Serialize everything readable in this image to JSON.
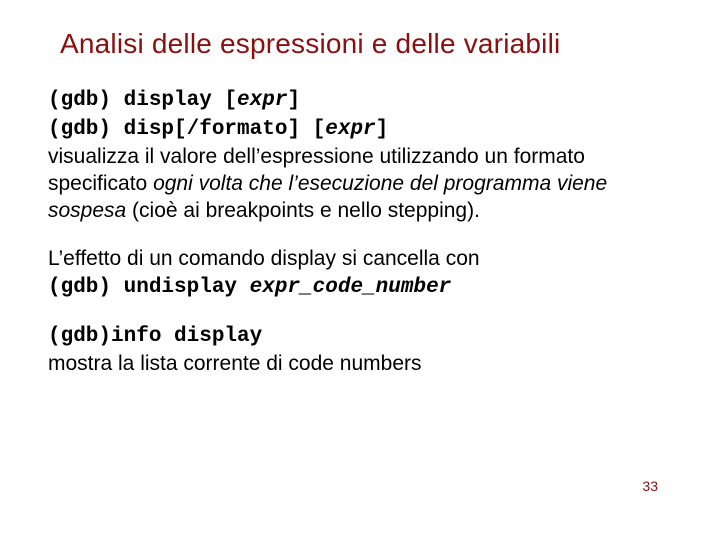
{
  "title": "Analisi delle espressioni e delle variabili",
  "p1": {
    "l1a": "(gdb) display [",
    "l1b": "expr",
    "l1c": "]",
    "l2a": "(gdb) disp[/formato] [",
    "l2b": "expr",
    "l2c": "]",
    "t1": "visualizza il valore dell’espressione utilizzando un formato specificato ",
    "t2": "ogni volta che l’esecuzione del programma viene sospesa",
    "t3": " (cioè ai breakpoints e nello stepping)."
  },
  "p2": {
    "t1": "L’effetto di un comando display si cancella con",
    "l1a": "(gdb) undisplay ",
    "l1b": "expr_code_number"
  },
  "p3": {
    "l1": "(gdb)info display",
    "t1": "mostra la lista corrente di code numbers"
  },
  "page": "33"
}
